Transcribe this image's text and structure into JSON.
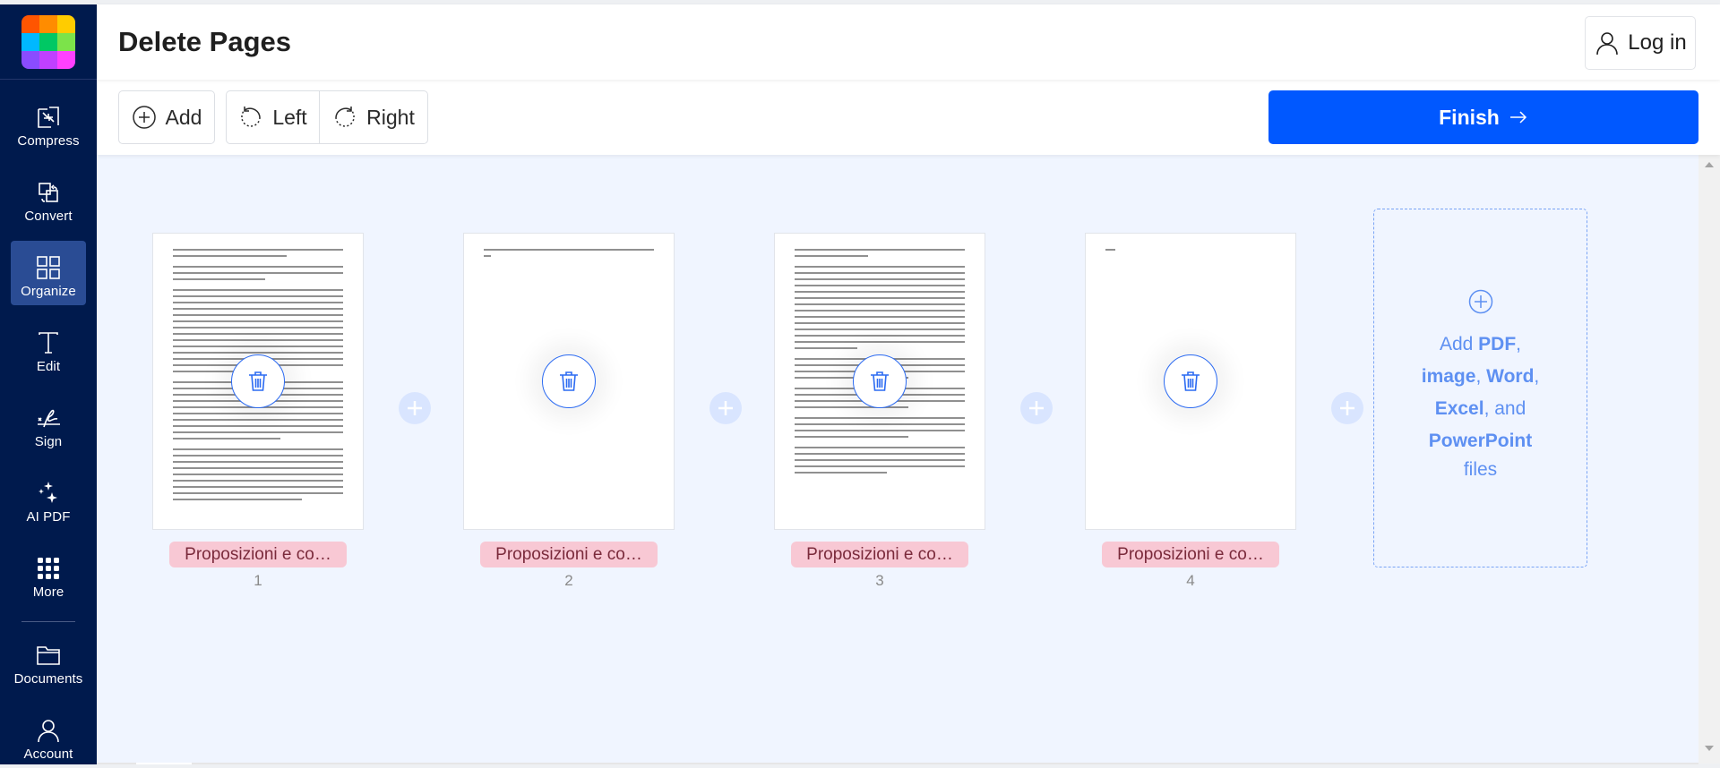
{
  "app": {
    "logo_colors": [
      "#ff5500",
      "#ff8c00",
      "#ffcc00",
      "#00b8ff",
      "#00c864",
      "#7ce34a",
      "#8a4cff",
      "#c040ff",
      "#ff40ff"
    ]
  },
  "sidebar": {
    "items": [
      {
        "label": "Compress",
        "icon": "compress-icon",
        "active": false
      },
      {
        "label": "Convert",
        "icon": "convert-icon",
        "active": false
      },
      {
        "label": "Organize",
        "icon": "organize-icon",
        "active": true
      },
      {
        "label": "Edit",
        "icon": "edit-text-icon",
        "active": false
      },
      {
        "label": "Sign",
        "icon": "signature-icon",
        "active": false
      },
      {
        "label": "AI PDF",
        "icon": "sparkles-icon",
        "active": false
      },
      {
        "label": "More",
        "icon": "grid-dots-icon",
        "active": false
      },
      {
        "label": "Documents",
        "icon": "folder-icon",
        "active": false
      },
      {
        "label": "Account",
        "icon": "user-icon",
        "active": false
      }
    ]
  },
  "header": {
    "title": "Delete Pages",
    "login_label": "Log in"
  },
  "toolbar": {
    "add_label": "Add",
    "rotate_left_label": "Left",
    "rotate_right_label": "Right",
    "finish_label": "Finish"
  },
  "pages": [
    {
      "number": "1",
      "file_name": "Proposizioni e co…",
      "content": "dense-text"
    },
    {
      "number": "2",
      "file_name": "Proposizioni e co…",
      "content": "two-lines"
    },
    {
      "number": "3",
      "file_name": "Proposizioni e co…",
      "content": "dense-text"
    },
    {
      "number": "4",
      "file_name": "Proposizioni e co…",
      "content": "one-word"
    }
  ],
  "add_zone": {
    "w1": "Add ",
    "b1": "PDF",
    "c1": ",",
    "b2": "image",
    "c2": ", ",
    "b3": "Word",
    "c3": ",",
    "b4": "Excel",
    "c4": ", and",
    "b5": "PowerPoint",
    "w2": "files"
  },
  "colors": {
    "sidebar_bg": "#001a4d",
    "active_nav": "#2a4c94",
    "primary": "#0058ff",
    "workspace_bg": "#f0f5ff",
    "badge_bg": "#f8c8d4"
  }
}
